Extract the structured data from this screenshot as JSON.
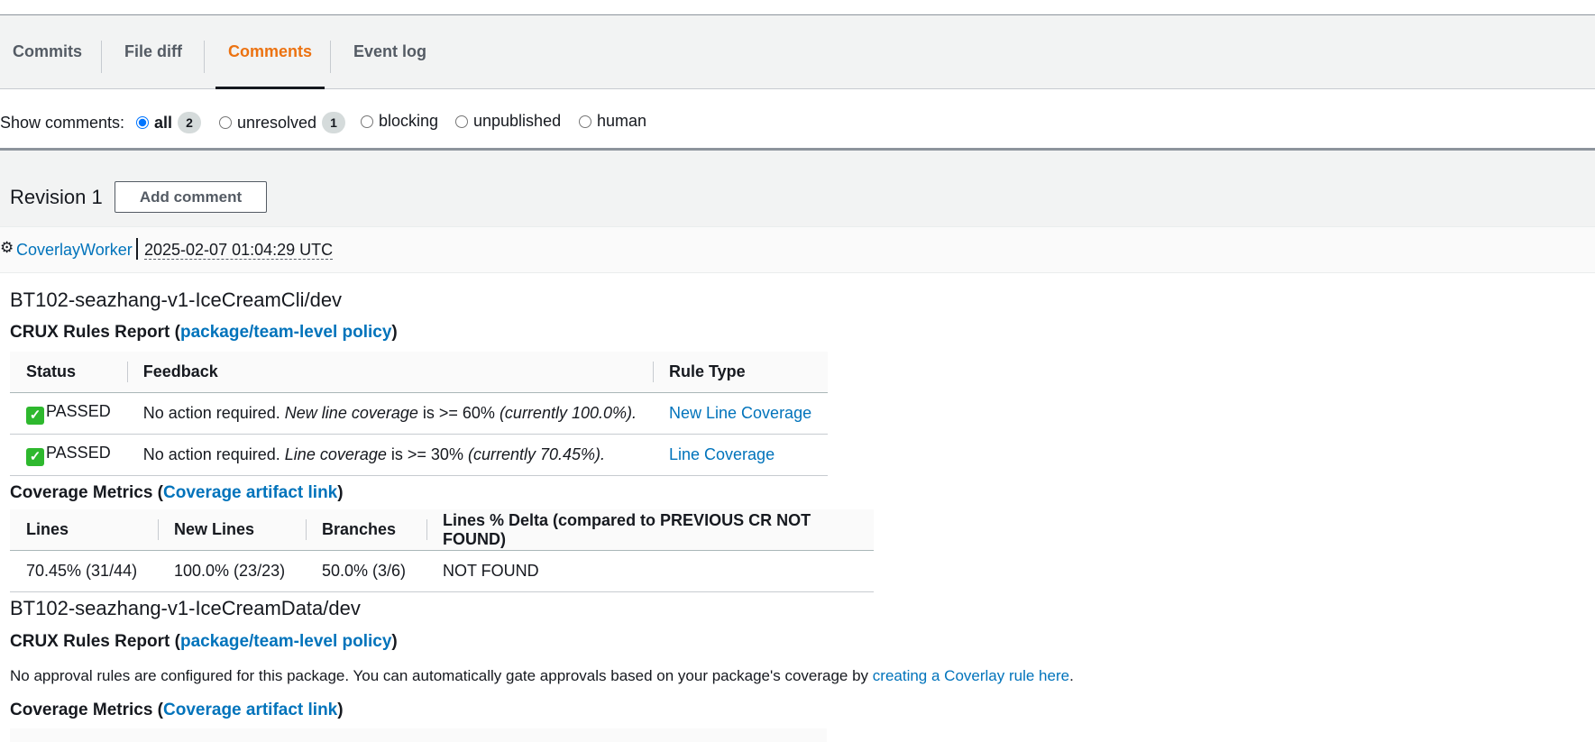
{
  "tabs": [
    "Commits",
    "File diff",
    "Comments",
    "Event log"
  ],
  "active_tab": "Comments",
  "filter": {
    "label": "Show comments:",
    "options": [
      {
        "label": "all",
        "count": "2",
        "checked": true
      },
      {
        "label": "unresolved",
        "count": "1",
        "checked": false
      },
      {
        "label": "blocking",
        "checked": false
      },
      {
        "label": "unpublished",
        "checked": false
      },
      {
        "label": "human",
        "checked": false
      }
    ]
  },
  "revision": {
    "title": "Revision 1",
    "add_comment_label": "Add comment",
    "author": "CoverlayWorker",
    "timestamp": "2025-02-07 01:04:29 UTC"
  },
  "packages": [
    {
      "name": "BT102-seazhang-v1-IceCreamCli/dev",
      "rules_heading": "CRUX Rules Report (",
      "rules_link": "package/team-level policy",
      "rules_close": ")",
      "rules_columns": [
        "Status",
        "Feedback",
        "Rule Type"
      ],
      "rules_rows": [
        {
          "status": "PASSED",
          "feedback_prefix": "No action required. ",
          "feedback_metric": "New line coverage",
          "feedback_mid": " is >= 60% ",
          "feedback_current": "(currently 100.0%).",
          "rule_type": "New Line Coverage"
        },
        {
          "status": "PASSED",
          "feedback_prefix": "No action required. ",
          "feedback_metric": "Line coverage",
          "feedback_mid": " is >= 30% ",
          "feedback_current": "(currently 70.45%).",
          "rule_type": "Line Coverage"
        }
      ],
      "metrics_heading": "Coverage Metrics (",
      "metrics_link": "Coverage artifact link",
      "metrics_close": ")",
      "metrics_columns": [
        "Lines",
        "New Lines",
        "Branches",
        "Lines % Delta (compared to PREVIOUS CR NOT FOUND)"
      ],
      "metrics_row": [
        "70.45% (31/44)",
        "100.0% (23/23)",
        "50.0% (3/6)",
        "NOT FOUND"
      ]
    },
    {
      "name": "BT102-seazhang-v1-IceCreamData/dev",
      "rules_heading": "CRUX Rules Report (",
      "rules_link": "package/team-level policy",
      "rules_close": ")",
      "no_rules_text": "No approval rules are configured for this package. You can automatically gate approvals based on your package's coverage by ",
      "no_rules_link": "creating a Coverlay rule here",
      "no_rules_end": ".",
      "metrics_heading": "Coverage Metrics (",
      "metrics_link": "Coverage artifact link",
      "metrics_close": ")"
    }
  ],
  "colors": {
    "accent": "#ec7211",
    "link": "#0073bb",
    "check": "#2eb82e"
  },
  "icons": [
    "gear-icon",
    "check-icon"
  ]
}
